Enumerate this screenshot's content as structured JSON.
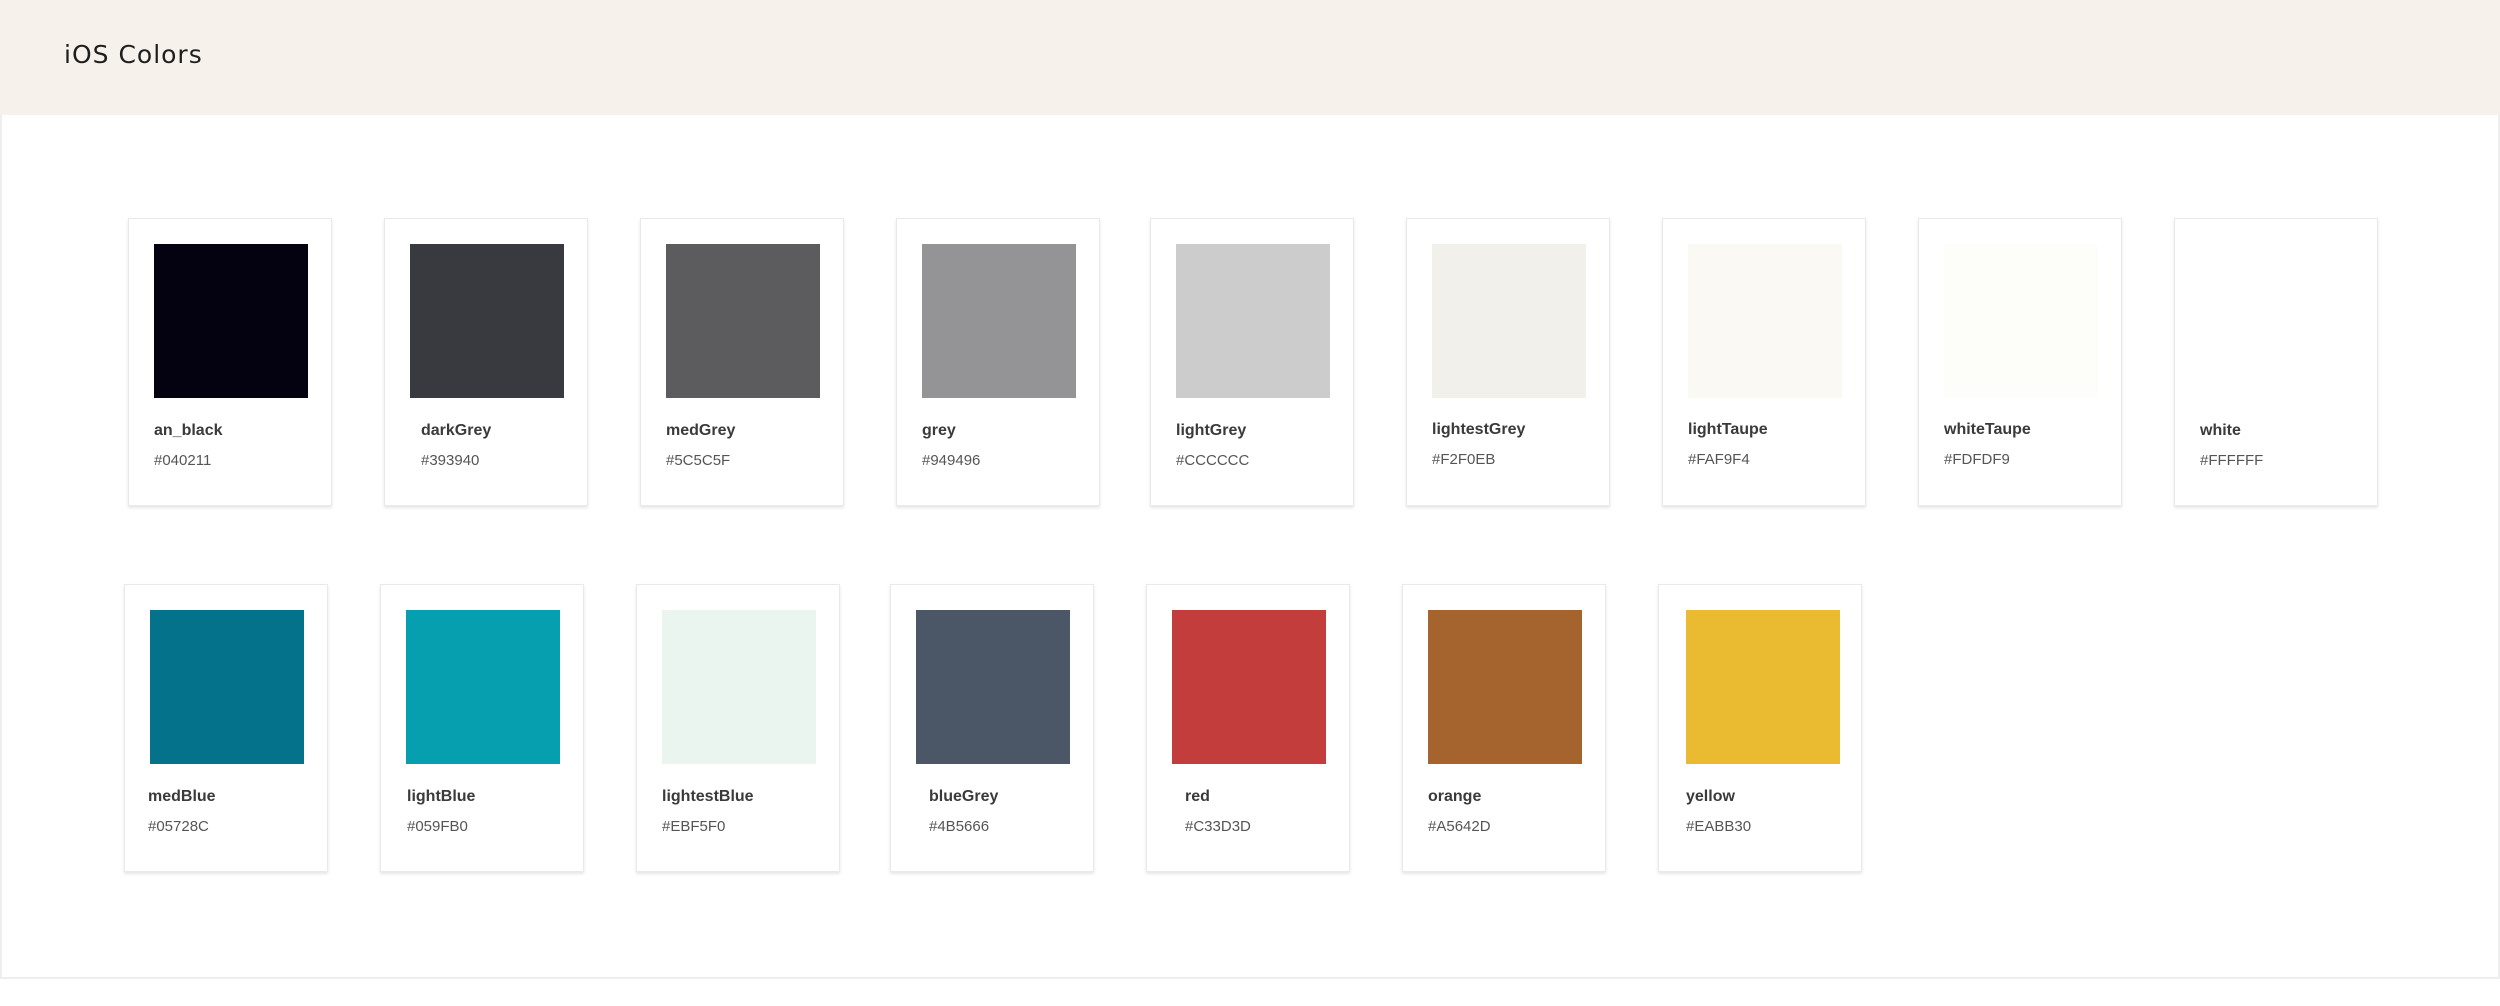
{
  "page": {
    "title": "iOS Colors"
  },
  "swatches": [
    {
      "name": "an_black",
      "hex": "#040211",
      "color": "#040211"
    },
    {
      "name": "darkGrey",
      "hex": "#393940",
      "color": "#393940"
    },
    {
      "name": "medGrey",
      "hex": "#5C5C5F",
      "color": "#5C5C5F"
    },
    {
      "name": "grey",
      "hex": "#949496",
      "color": "#949496"
    },
    {
      "name": "lightGrey",
      "hex": "#CCCCCC",
      "color": "#CCCCCC"
    },
    {
      "name": "lightestGrey",
      "hex": "#F2F0EB",
      "color": "#F2F0EB"
    },
    {
      "name": "lightTaupe",
      "hex": "#FAF9F4",
      "color": "#FAF9F4"
    },
    {
      "name": "whiteTaupe",
      "hex": "#FDFDF9",
      "color": "#FDFDF9"
    },
    {
      "name": "white",
      "hex": "#FFFFFF",
      "color": "#FFFFFF"
    },
    {
      "name": "medBlue",
      "hex": "#05728C",
      "color": "#05728C"
    },
    {
      "name": "lightBlue",
      "hex": "#059FB0",
      "color": "#059FB0"
    },
    {
      "name": "lightestBlue",
      "hex": "#EBF5F0",
      "color": "#EBF5F0"
    },
    {
      "name": "blueGrey",
      "hex": "#4B5666",
      "color": "#4B5666"
    },
    {
      "name": "red",
      "hex": "#C33D3D",
      "color": "#C33D3D"
    },
    {
      "name": "orange",
      "hex": "#A5642D",
      "color": "#A5642D"
    },
    {
      "name": "yellow",
      "hex": "#EABB30",
      "color": "#EABB30"
    }
  ]
}
